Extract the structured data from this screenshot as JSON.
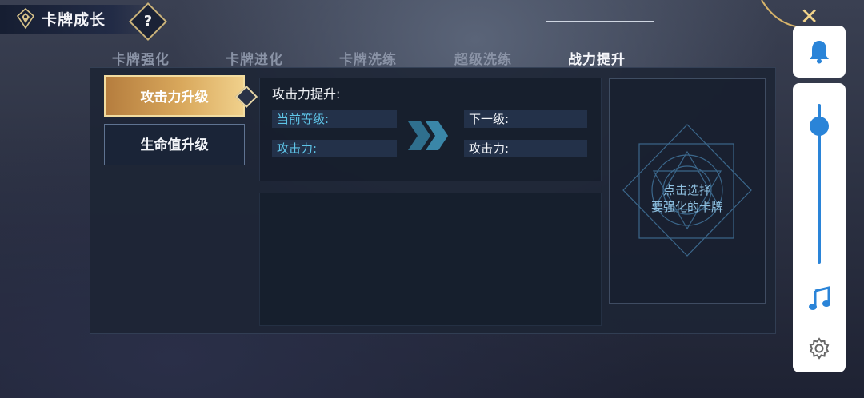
{
  "header": {
    "title": "卡牌成长",
    "help_glyph": "?",
    "close_glyph": "✕"
  },
  "tabs": [
    {
      "label": "卡牌强化",
      "active": false
    },
    {
      "label": "卡牌进化",
      "active": false
    },
    {
      "label": "卡牌洗练",
      "active": false
    },
    {
      "label": "超级洗练",
      "active": false
    },
    {
      "label": "战力提升",
      "active": true
    }
  ],
  "side_menu": [
    {
      "label": "攻击力升级",
      "active": true
    },
    {
      "label": "生命值升级",
      "active": false
    }
  ],
  "stats": {
    "title": "攻击力提升:",
    "current_level_label": "当前等级:",
    "current_attack_label": "攻击力:",
    "next_level_label": "下一级:",
    "next_attack_label": "攻击力:"
  },
  "select_card": {
    "line1": "点击选择",
    "line2": "要强化的卡牌"
  },
  "side_controls": {
    "volume_fraction": 0.86
  },
  "colors": {
    "accent_gold": "#d9a85c",
    "accent_blue": "#2a84d8",
    "label_cyan": "#5ec3e6"
  }
}
